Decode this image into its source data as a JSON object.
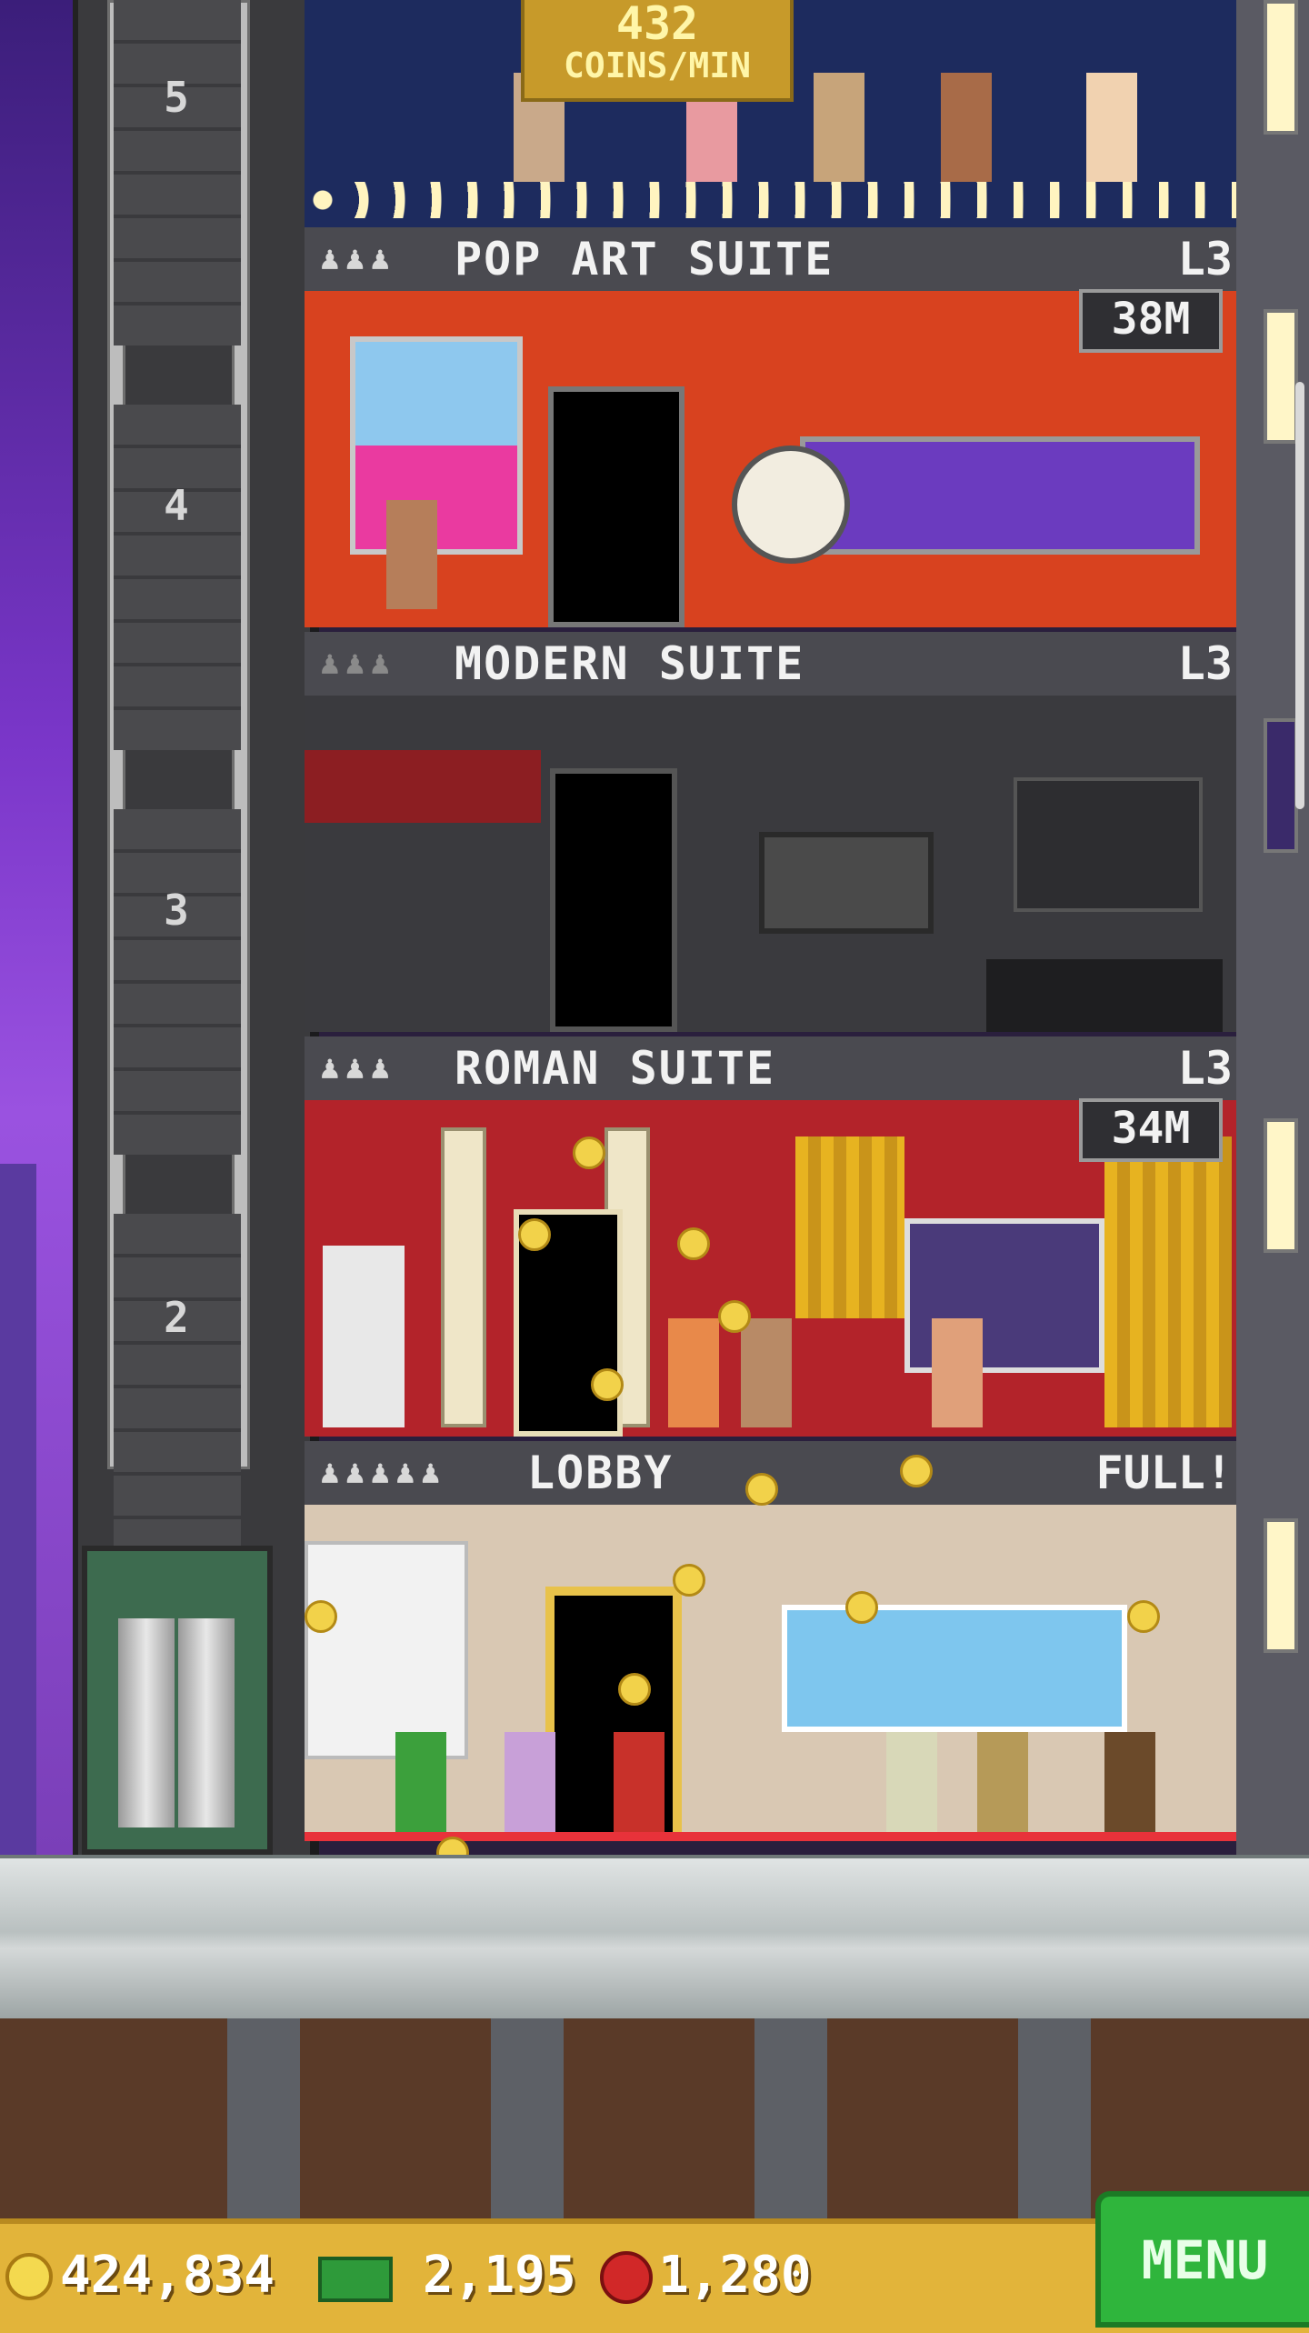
{
  "roof": {
    "coins_rate": "432",
    "coins_unit": "COINS/MIN"
  },
  "shaft": {
    "floor_numbers": [
      "5",
      "4",
      "3",
      "2"
    ]
  },
  "floors": [
    {
      "name": "POP ART SUITE",
      "level": "L3",
      "stock": "38M"
    },
    {
      "name": "MODERN SUITE",
      "level": "L3"
    },
    {
      "name": "ROMAN SUITE",
      "level": "L3",
      "stock": "34M"
    },
    {
      "name": "LOBBY",
      "level": "FULL!"
    }
  ],
  "resources": {
    "coins": "424,834",
    "tower_bux": "2,195",
    "gems": "1,280"
  },
  "menu": {
    "label": "MENU"
  },
  "icons": {
    "coin": "coin-icon",
    "bux": "bux-icon",
    "gem": "gem-icon",
    "person": "person-icon"
  },
  "colors": {
    "menu_green": "#2fb53c",
    "bottom_bar_gold": "#e2b43a",
    "pop_art_red": "#d8421f",
    "roman_red": "#b3232a"
  }
}
